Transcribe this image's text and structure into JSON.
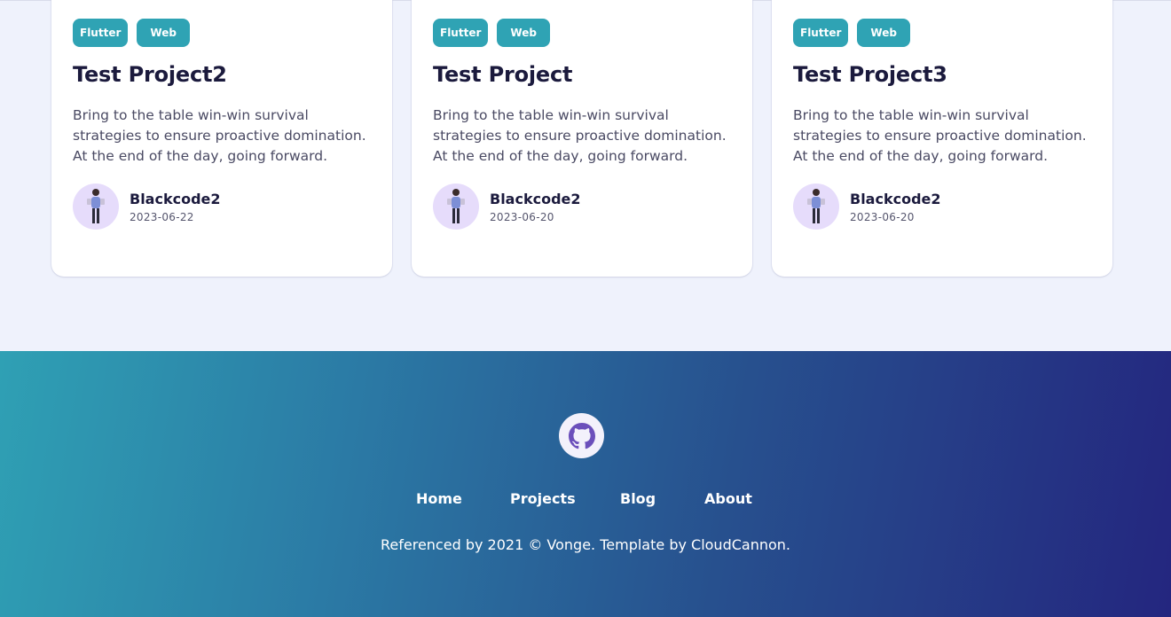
{
  "projects": [
    {
      "tags": [
        "Flutter",
        "Web"
      ],
      "title": "Test Project2",
      "description": "Bring to the table win-win survival strategies to ensure proactive domination. At the end of the day, going forward.",
      "author": "Blackcode2",
      "date": "2023-06-22"
    },
    {
      "tags": [
        "Flutter",
        "Web"
      ],
      "title": "Test Project",
      "description": "Bring to the table win-win survival strategies to ensure proactive domination. At the end of the day, going forward.",
      "author": "Blackcode2",
      "date": "2023-06-20"
    },
    {
      "tags": [
        "Flutter",
        "Web"
      ],
      "title": "Test Project3",
      "description": "Bring to the table win-win survival strategies to ensure proactive domination. At the end of the day, going forward.",
      "author": "Blackcode2",
      "date": "2023-06-20"
    }
  ],
  "footer": {
    "social_icon": "github-icon",
    "nav": [
      "Home",
      "Projects",
      "Blog",
      "About"
    ],
    "copyright": "Referenced by 2021 © Vonge. Template by CloudCannon."
  },
  "colors": {
    "tag_bg": "#2fa3b4",
    "title": "#1b1a3d",
    "page_bg": "#eff2fc",
    "footer_gradient_start": "#2fa0b4",
    "footer_gradient_end": "#24267f",
    "avatar_bg": "#e6dcfb",
    "github_icon": "#6b4fbb"
  }
}
